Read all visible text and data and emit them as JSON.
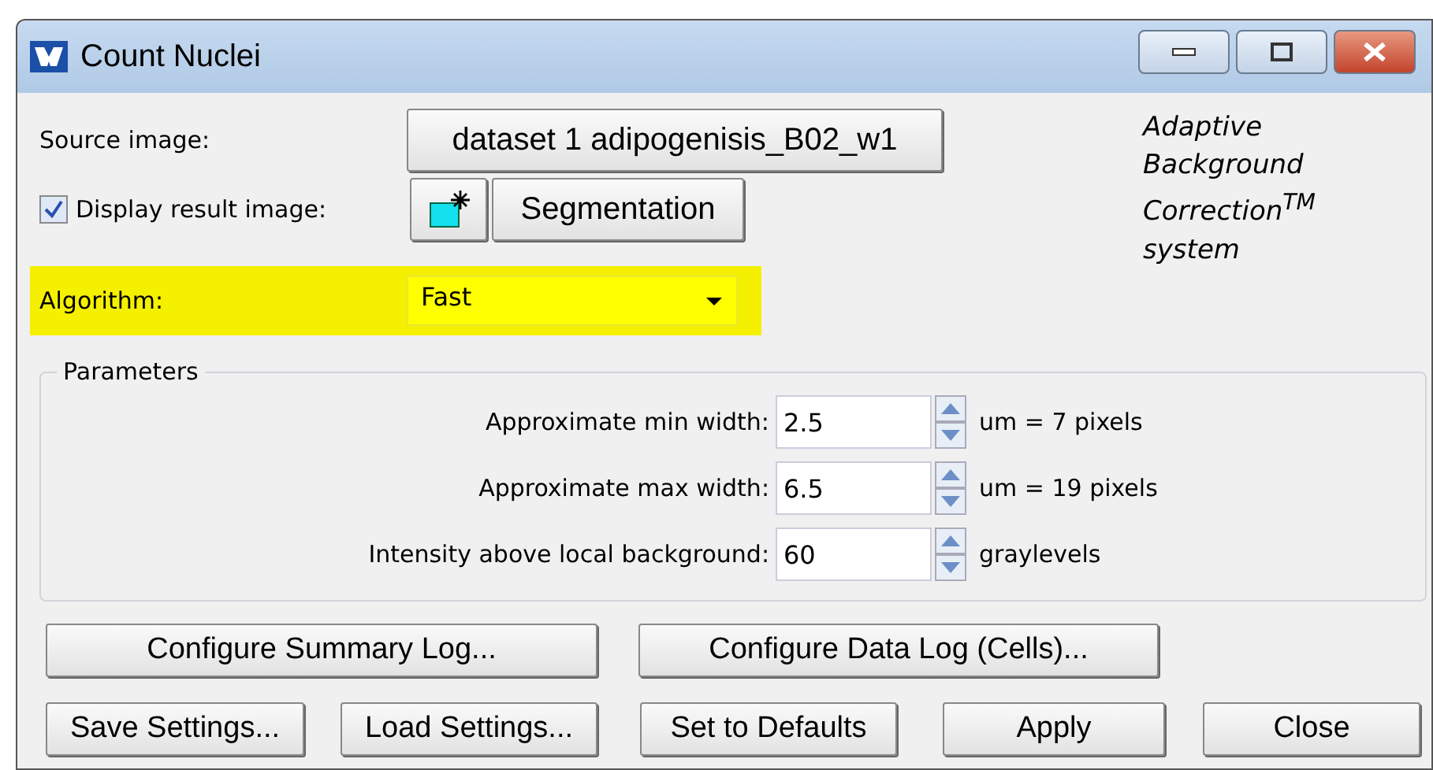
{
  "window": {
    "title": "Count Nuclei"
  },
  "source_image": {
    "label": "Source image:",
    "value": "dataset 1 adipogenisis_B02_w1"
  },
  "display_result": {
    "label": "Display result image:",
    "checked": true,
    "button": "Segmentation"
  },
  "branding": [
    "Adaptive",
    "Background",
    "Correction$^{TM}$",
    "system"
  ],
  "algorithm": {
    "label": "Algorithm:",
    "value": "Fast",
    "highlighted": true
  },
  "parameters": {
    "title": "Parameters",
    "rows": [
      {
        "label": "Approximate min width:",
        "value": "2.5",
        "unit": "um = 7 pixels"
      },
      {
        "label": "Approximate max width:",
        "value": "6.5",
        "unit": "um = 19 pixels"
      },
      {
        "label": "Intensity above local background:",
        "value": "60",
        "unit": "graylevels"
      }
    ]
  },
  "log_buttons": [
    "Configure Summary Log...",
    "Configure Data Log (Cells)..."
  ],
  "action_buttons": [
    "Save Settings...",
    "Load Settings...",
    "Set to Defaults",
    "Apply",
    "Close"
  ]
}
